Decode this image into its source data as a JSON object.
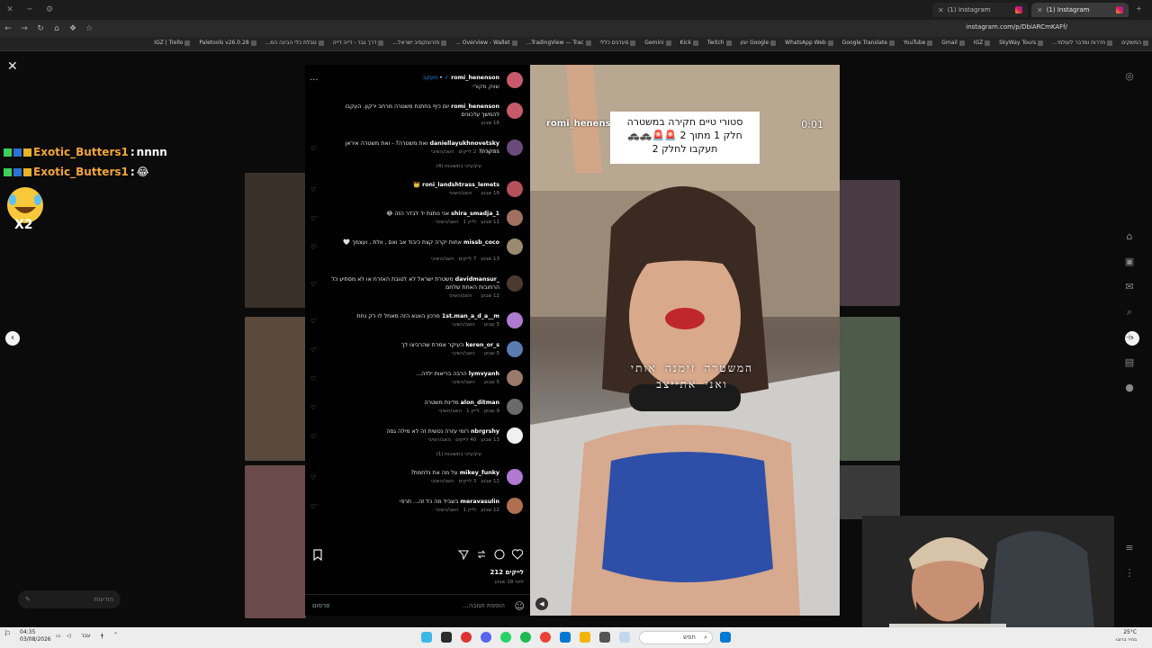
{
  "browser": {
    "tabs": [
      {
        "label": "(1) Instagram",
        "active": false
      },
      {
        "label": "(1) Instagram",
        "active": true
      }
    ],
    "url": "instagram.com/p/DbiARCmKAFf/",
    "bookmarks": [
      "IGZ | Trello",
      "Paletools v26.0.28",
      "טבלת כלי הבינה המ...",
      "דרך גבר - דייה דייה",
      "פזרונוקסיב ישראל...",
      "Overview - Wallet ...",
      "TradingView — Trac...",
      "סעדנים כללי",
      "Gemini",
      "Kick",
      "Twitch",
      "Google יומן",
      "WhatsApp Web",
      "Google Translate",
      "YouTube",
      "Gmail",
      "IGZ",
      "SkyWay Tours",
      "חדרות ומדבר לעולמי...",
      "המשקים"
    ]
  },
  "overlay_chat": [
    {
      "user": "Exotic_Butters1",
      "message": "nnnn"
    },
    {
      "user": "Exotic_Butters1",
      "message": "😂"
    }
  ],
  "overlay_emote_count": "X2",
  "notifications_label": "הודעות",
  "post": {
    "author": "romi_henenson",
    "author_caption": "שווק מקורי",
    "follow_label": "מעקב",
    "comments": [
      {
        "user": "romi_henenson",
        "text": "יום כיף בחתנת משטרה מרחב ירקון. העקבו להמשך עדכונים",
        "time": "16 שבוע",
        "likes": "",
        "reply": ""
      },
      {
        "user": "daniellayukhnovetsky",
        "text": "ואת משטרה? - ואת משטרה איראן בחקרה?",
        "time": "14 שבוע",
        "likes": "2 לייקים",
        "reply": "השב/השיבי",
        "replies_link": "עיין/עייני בתשובות (4)"
      },
      {
        "user": "roni_landshtrass_lemets",
        "text": "👑",
        "time": "16 שבוע",
        "likes": "",
        "reply": "השב/השיבי"
      },
      {
        "user": "shira_smadja_1",
        "text": "אני נותנת יד לבדר הזה 😂",
        "time": "11 שבוע",
        "likes": "לייק 1",
        "reply": "השב/השיבי"
      },
      {
        "user": "missb_coco",
        "text": "אחות יקרה קצת כיבוד אב ואם , וולת , ועצמך 🤍",
        "time": "13 שבוע",
        "likes": "7 לייקים",
        "reply": "השב/השיבי"
      },
      {
        "user": "_davidmansur",
        "text": "משטרת ישראל לא לטובת האזרח או לא מסתיע כל הרחובות האחת שלחם",
        "time": "12 שבוע",
        "likes": "",
        "reply": "השב/השיבי"
      },
      {
        "user": "1st.man_a_d_a__m",
        "text": "מרכון האנא הזה מאחל לו רק נחת",
        "time": "5 שבוע",
        "likes": "",
        "reply": "השב/השיבי"
      },
      {
        "user": "keren_or_s",
        "text": "העיקר אמרת שהרביצו לך",
        "time": "5 שבוע",
        "likes": "",
        "reply": "השב/השיבי"
      },
      {
        "user": "lymvyanh",
        "text": "הרבה בריאות ילדה...",
        "time": "5 שבוע",
        "likes": "",
        "reply": "השב/השיבי"
      },
      {
        "user": "alon_ditman",
        "text": "מדינת משטרה",
        "time": "9 שבוע",
        "likes": "לייק 1",
        "reply": "השב/השיבי"
      },
      {
        "user": "nbrgrshy",
        "text": "רומי עזרה נטשית זה לא מילה גסה",
        "time": "13 שבוע",
        "likes": "40 לייקים",
        "reply": "השב/השיבי",
        "replies_link": "עיין/עייני בתשובות (1)"
      },
      {
        "user": "mikey_funky",
        "text": "על מה את נלחמת?",
        "time": "12 שבוע",
        "likes": "3 לייקים",
        "reply": "השב/השיבי"
      },
      {
        "user": "meravasulin",
        "text": "בשביל מה כל זה... תרפי",
        "time": "12 שבוע",
        "likes": "לייק 1",
        "reply": "השב/השיבי"
      }
    ],
    "likes_count": "212 לייקים",
    "posted_when": "לפני 18 שבוע",
    "add_comment_placeholder": "הוספת תגובה...",
    "publish_label": "פרסום"
  },
  "story": {
    "username": "romi_henenson",
    "time": "0:01",
    "card_lines": [
      "סטורי טיים חקירה במשטרה",
      "חלק 1 מתוך 2 🚨🚨🚓🚓",
      "תעקבו לחלק 2"
    ],
    "caption_lines": [
      "המשטרה זימנה אותי",
      "ואני אתייצב"
    ]
  },
  "taskbar": {
    "time": "04:35",
    "date": "03/08/2026",
    "lang": "עבר",
    "search_placeholder": "חפש",
    "weather": "25°C",
    "weather_desc": "בהיר ברובו"
  },
  "colors": {
    "chat_username": "#f3a537",
    "accent_blue": "#0095f6",
    "bg": "#0b0b0b"
  }
}
